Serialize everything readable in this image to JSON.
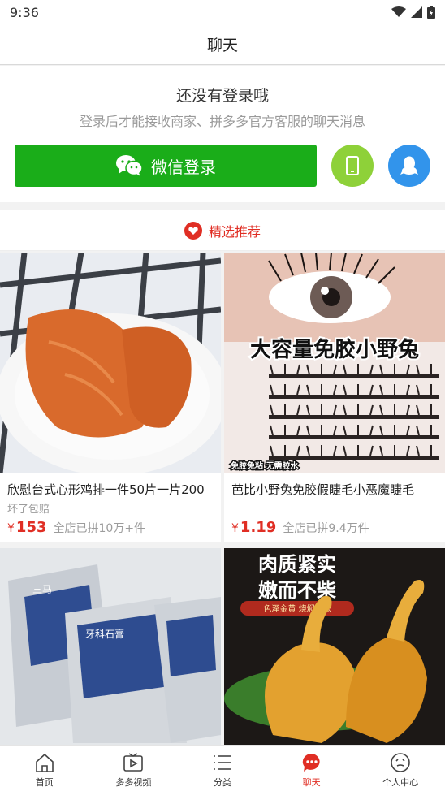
{
  "status_bar": {
    "time": "9:36"
  },
  "nav": {
    "title": "聊天"
  },
  "login": {
    "heading": "还没有登录哦",
    "subtext": "登录后才能接收商家、拼多多官方客服的聊天消息",
    "wechat_button": "微信登录"
  },
  "recommend": {
    "label": "精选推荐"
  },
  "products": [
    {
      "title": "欣慰台式心形鸡排一件50片一片200",
      "tag": "坏了包赔",
      "price_symbol": "¥",
      "price": "153",
      "sales": "全店已拼10万+件"
    },
    {
      "title": "芭比小野兔免胶假睫毛小恶魔睫毛",
      "tag": "",
      "price_symbol": "¥",
      "price": "1.19",
      "sales": "全店已拼9.4万件"
    },
    {
      "title": "",
      "image_text_1": "三马",
      "image_text_2": "牙科石膏"
    },
    {
      "title": "",
      "image_text_1": "肉质紧实",
      "image_text_2": "嫩而不柴",
      "image_text_3": "色泽金黄 烧焖风味"
    }
  ],
  "image_texts": {
    "eyelash_banner": "大容量免胶小野兔",
    "eyelash_sticker": "免胶免粘 无需胶水"
  },
  "tabs": [
    {
      "label": "首页",
      "icon": "home-icon"
    },
    {
      "label": "多多视频",
      "icon": "video-icon"
    },
    {
      "label": "分类",
      "icon": "category-icon"
    },
    {
      "label": "聊天",
      "icon": "chat-icon",
      "active": true
    },
    {
      "label": "个人中心",
      "icon": "profile-icon"
    }
  ],
  "colors": {
    "brand_red": "#e02e24",
    "wechat_green": "#1aad19",
    "phone_green": "#8ed139",
    "qq_blue": "#3294eb"
  }
}
